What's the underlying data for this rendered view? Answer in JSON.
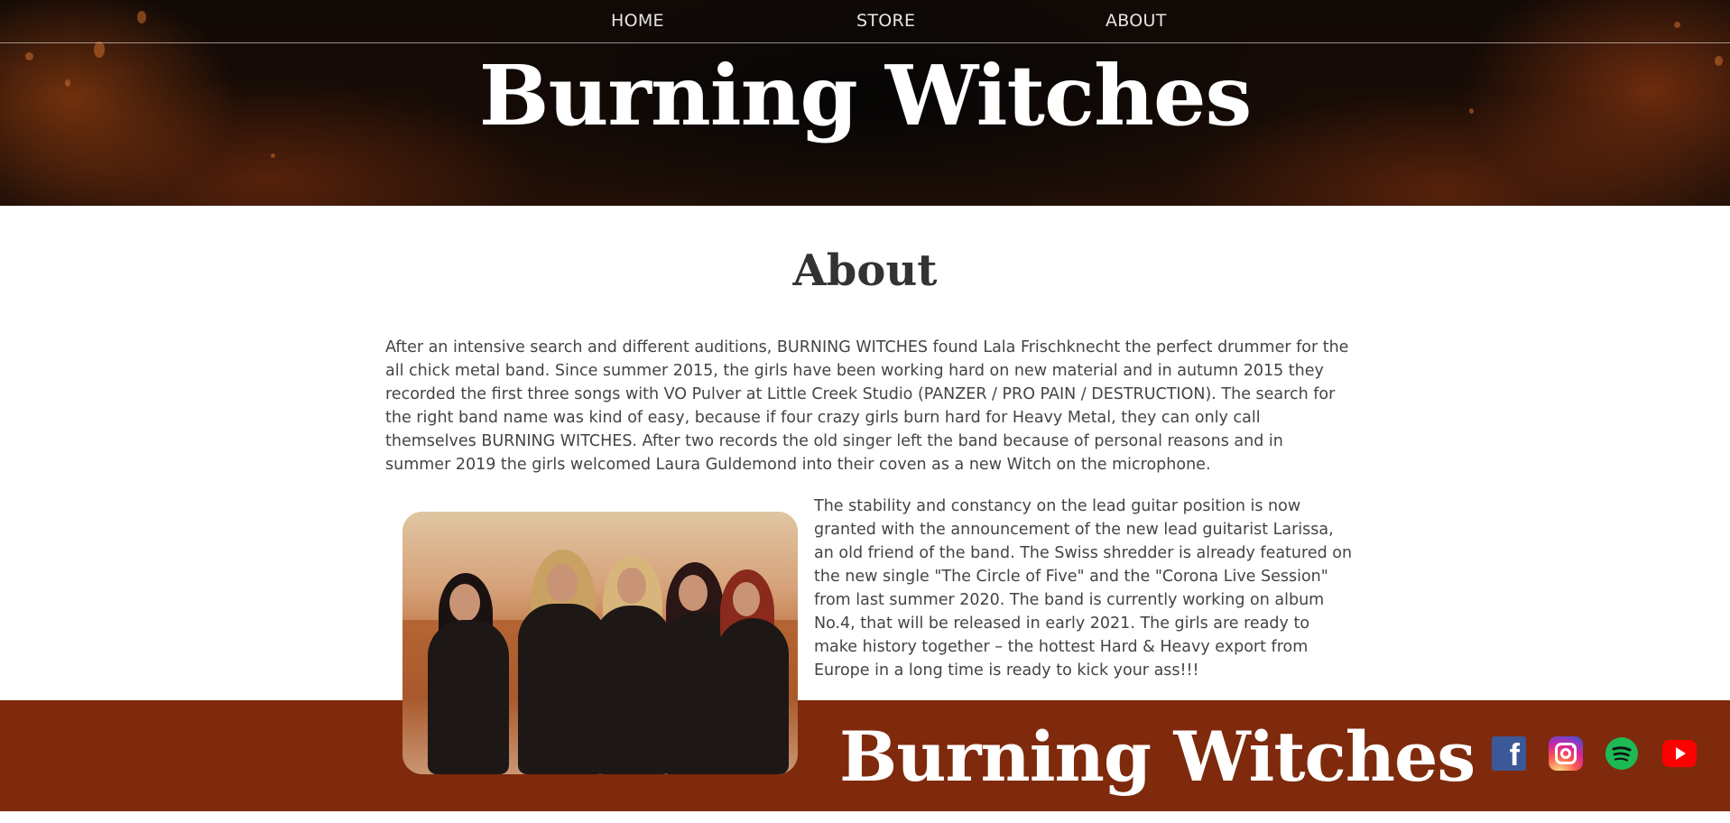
{
  "nav": {
    "items": [
      {
        "label": "HOME"
      },
      {
        "label": "STORE"
      },
      {
        "label": "ABOUT"
      }
    ]
  },
  "header": {
    "logo_text": "Burning Witches"
  },
  "main": {
    "title": "About",
    "paragraph_1": "After an intensive search and different auditions, BURNING WITCHES found Lala Frischknecht the perfect drummer for the all chick metal band. Since summer 2015, the girls have been working hard on new material and in autumn 2015 they recorded the first three songs with VO Pulver at Little Creek Studio (PANZER / PRO PAIN / DESTRUCTION). The search for the right band name was kind of easy, because if four crazy girls burn hard for Heavy Metal, they can only call themselves BURNING WITCHES. After two records the old singer left the band because of personal reasons and in summer 2019 the girls welcomed Laura Guldemond into their coven as a new Witch on the microphone.",
    "paragraph_2": "The stability and constancy on the lead guitar position is now granted with the announcement of the new lead guitarist Larissa, an old friend of the band. The Swiss shredder is already featured on the new single \"The Circle of Five\" and the \"Corona Live Session\" from last summer 2020. The band is currently working on album No.4, that will be released in early 2021. The girls are ready to make history together – the hottest Hard & Heavy export from Europe in a long time is ready to kick your ass!!!"
  },
  "footer": {
    "logo_text": "Burning Witches",
    "social": [
      {
        "icon": "facebook-icon",
        "glyph": "f"
      },
      {
        "icon": "instagram-icon"
      },
      {
        "icon": "spotify-icon"
      },
      {
        "icon": "youtube-icon"
      }
    ]
  },
  "colors": {
    "footer_bg": "#7f2a0c",
    "text": "#444444",
    "title": "#333333"
  }
}
